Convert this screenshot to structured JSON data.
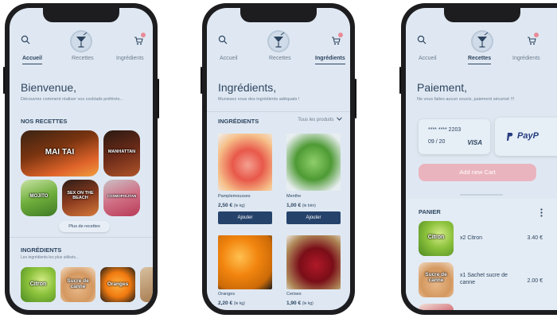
{
  "colors": {
    "screen_bg": "#dfe8f2",
    "primary_text": "#2d4560",
    "secondary_text": "#6c7c90",
    "button_navy": "#25426b",
    "button_pink": "#eab4be",
    "cart_badge": "#e88a96"
  },
  "icons": [
    "search-icon",
    "cocktail-logo-icon",
    "cart-icon",
    "chevron-down-icon",
    "more-vertical-icon",
    "paypal-icon"
  ],
  "phone1": {
    "tabs": [
      "Accueil",
      "Recettes",
      "Ingrédients"
    ],
    "active_tab": "Accueil",
    "title": "Bienvenue,",
    "subtitle": "Découvrez comment réaliser vos cocktails préférés...",
    "recipes_title": "NOS RECETTES",
    "recipes": [
      "MAI TAI",
      "MANHATTAN",
      "MOJITO",
      "SEX ON THE BEACH",
      "COSMOPOLITAN"
    ],
    "more_button": "Plus de recettes",
    "ingredients_title": "INGRÉDIENTS",
    "ingredients_sub": "Les ingrédients les plus utilisés...",
    "ingredients": [
      "Citron",
      "Sucre de canne",
      "Oranges"
    ]
  },
  "phone2": {
    "tabs": [
      "Accueil",
      "Recettes",
      "Ingrédients"
    ],
    "active_tab": "Ingrédients",
    "title": "Ingrédients,",
    "subtitle": "Munissez vous des ingrédients adéquats !",
    "section_title": "INGRÉDIENTS",
    "filter": "Tous les produits",
    "products": [
      {
        "name": "Pamplemousses",
        "price": "2,50 €",
        "unit": "(le kg)",
        "button": "Ajouter"
      },
      {
        "name": "Menthe",
        "price": "1,00 €",
        "unit": "(le brin)",
        "button": "Ajouter"
      },
      {
        "name": "Oranges",
        "price": "2,20 €",
        "unit": "(le kg)"
      },
      {
        "name": "Cerises",
        "price": "1,90 €",
        "unit": "(le kg)"
      }
    ]
  },
  "phone3": {
    "tabs": [
      "Accueil",
      "Recettes",
      "Ingrédients"
    ],
    "active_tab": "Recettes",
    "title": "Paiement,",
    "subtitle": "Ne vous faites aucun soucis, paiement sécurisé !!!",
    "card_number": "**** **** 2203",
    "card_expiry": "09 / 20",
    "card_brand": "VISA",
    "paypal_label": "PayP",
    "add_card_button": "Add new Cart",
    "cart_title": "PANIER",
    "cart_items": [
      {
        "image_label": "Citron",
        "description": "x2 Citron",
        "price": "3.40 €"
      },
      {
        "image_label": "Sucre de canne",
        "description": "x1 Sachet sucre de canne",
        "price": "2.00 €"
      }
    ]
  }
}
